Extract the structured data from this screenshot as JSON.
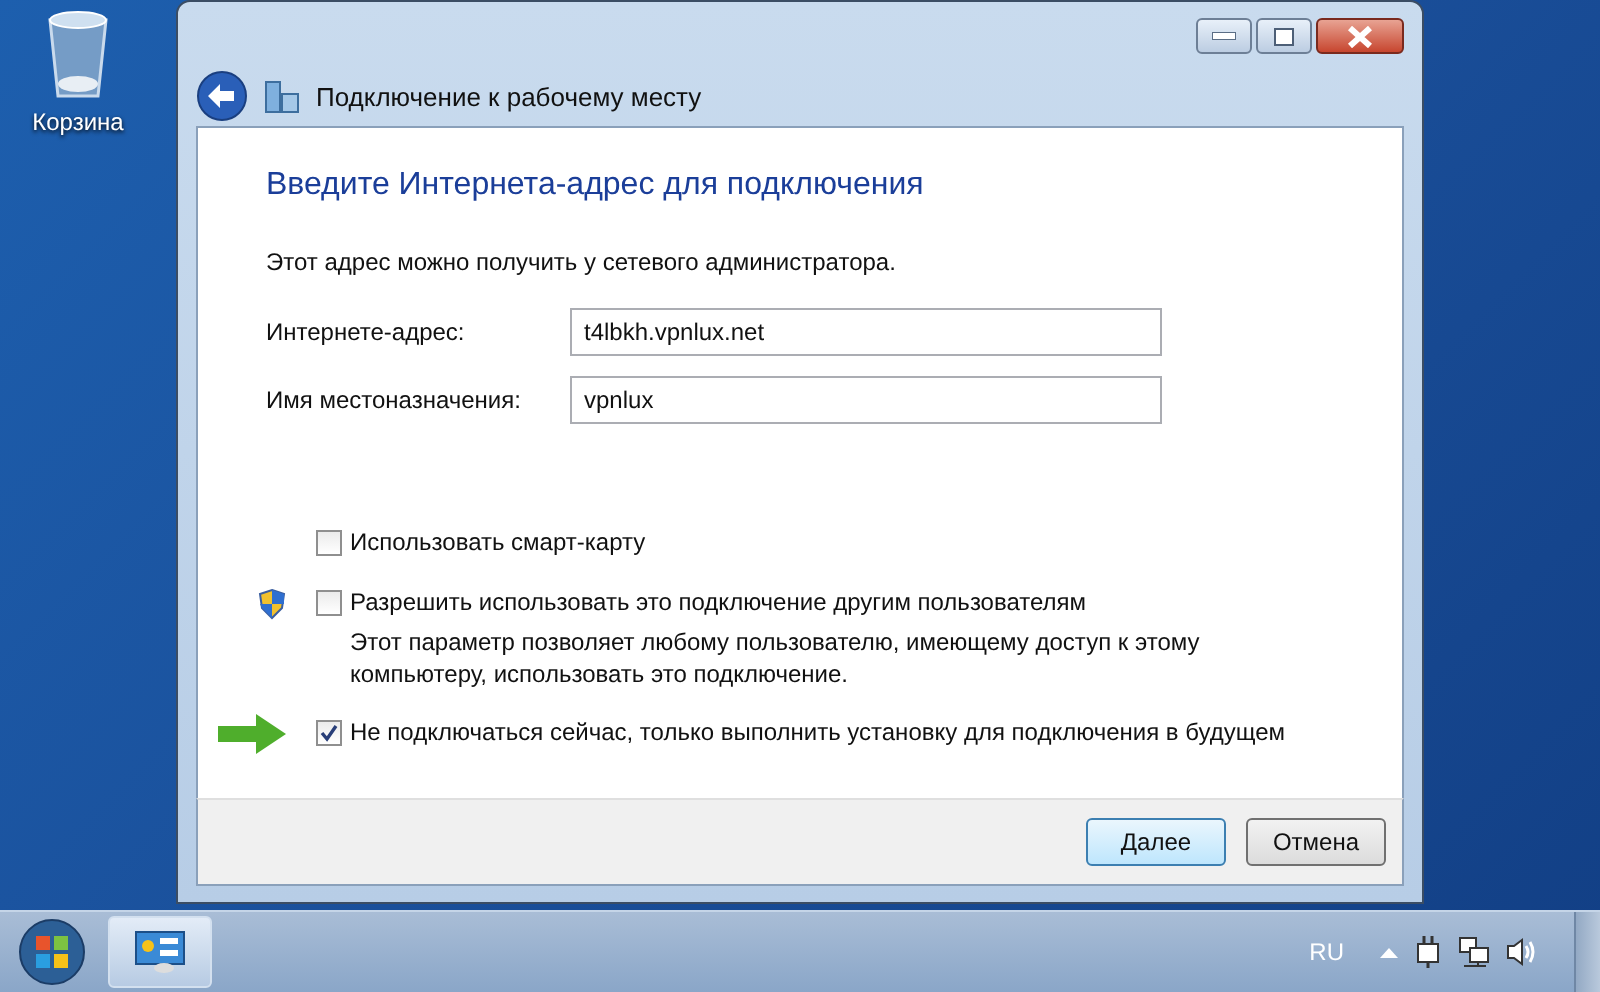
{
  "desktop": {
    "icons": [
      {
        "label": "Корзина"
      }
    ]
  },
  "window": {
    "title": "Подключение к рабочему месту",
    "heading": "Введите Интернета-адрес для подключения",
    "intro": "Этот адрес можно получить у сетевого администратора.",
    "fields": [
      {
        "label": "Интернете-адрес:",
        "value": "t4lbkh.vpnlux.net"
      },
      {
        "label": "Имя местоназначения:",
        "value": "vpnlux"
      }
    ],
    "options": [
      {
        "kind": "plain",
        "label": "Использовать смарт-карту",
        "checked": false,
        "pointer": false
      },
      {
        "kind": "admin",
        "label": "Разрешить использовать это подключение другим пользователям",
        "description": "Этот параметр позволяет любому пользователю, имеющему доступ к этому компьютеру, использовать это подключение.",
        "checked": false,
        "pointer": false
      },
      {
        "kind": "plain",
        "label": "Не подключаться сейчас, только выполнить установку для подключения в будущем",
        "checked": true,
        "pointer": true
      }
    ],
    "buttons": [
      {
        "label": "Далее",
        "default": true
      },
      {
        "label": "Отмена",
        "default": false
      }
    ]
  },
  "taskbar": {
    "language": "RU"
  }
}
